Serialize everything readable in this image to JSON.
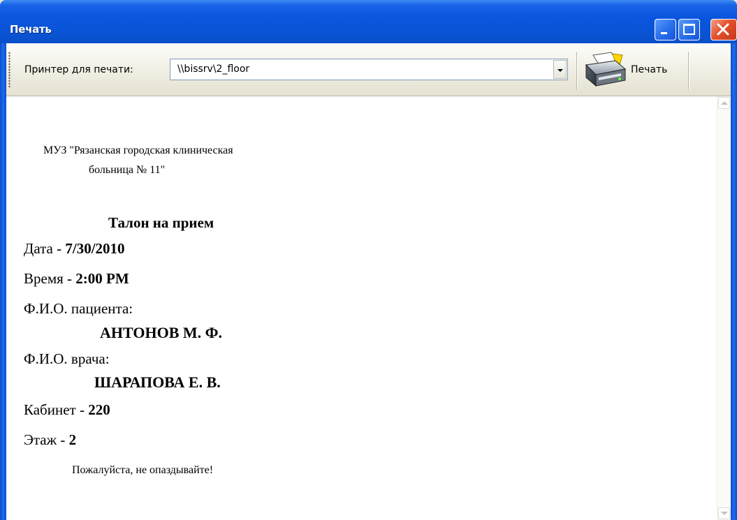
{
  "window": {
    "title": "Печать"
  },
  "toolbar": {
    "printer_label": "Принтер для печати:",
    "printer_value": "\\\\bissrv\\2_floor",
    "print_label": "Печать"
  },
  "ticket": {
    "org_line1": "МУЗ \"Рязанская городская клиническая",
    "org_line2": "больница № 11\"",
    "heading": "Талон на прием",
    "date_label": "Дата - ",
    "date_value": "7/30/2010",
    "time_label": "Время - ",
    "time_value": "2:00 PM",
    "patient_label": "Ф.И.О. пациента:",
    "patient_value": "АНТОНОВ М. Ф.",
    "doctor_label": "Ф.И.О. врача:",
    "doctor_value": "ШАРАПОВА Е. В.",
    "room_label": "Кабинет - ",
    "room_value": "220",
    "floor_label": "Этаж - ",
    "floor_value": "2",
    "footer": "Пожалуйста, не опаздывайте!"
  },
  "colors": {
    "titlebar": "#0a55de",
    "close_button": "#e5512c",
    "toolbar": "#f1efe4"
  }
}
